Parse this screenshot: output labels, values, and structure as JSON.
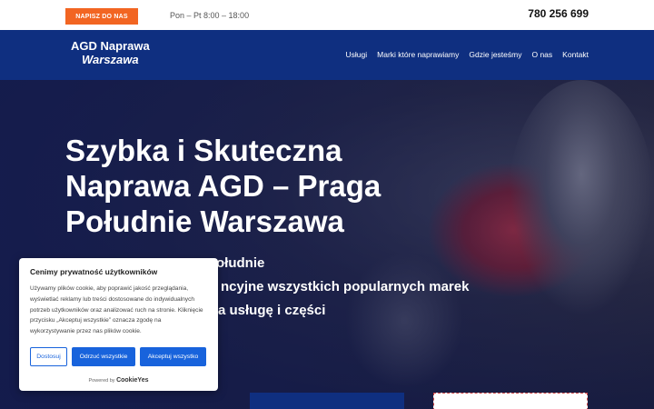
{
  "topbar": {
    "cta_label": "NAPISZ DO NAS",
    "hours": "Pon – Pt 8:00 – 18:00",
    "phone": "780 256 699"
  },
  "header": {
    "logo_line1": "AGD Naprawa",
    "logo_line2": "Warszawa",
    "nav": [
      "Usługi",
      "Marki które naprawiamy",
      "Gdzie jesteśmy",
      "O nas",
      "Kontakt"
    ]
  },
  "hero": {
    "title": "Szybka i Skuteczna Naprawa AGD – Praga Południe Warszawa",
    "bullets": [
      "ołudnie",
      "ncyjne wszystkich popularnych marek",
      "a usługę i części"
    ]
  },
  "cookie": {
    "title": "Cenimy prywatność użytkowników",
    "text": "Używamy plików cookie, aby poprawić jakość przeglądania, wyświetlać reklamy lub treści dostosowane do indywidualnych potrzeb użytkowników oraz analizować ruch na stronie. Kliknięcie przycisku „Akceptuj wszystkie” oznacza zgodę na wykorzystywanie przez nas plików cookie.",
    "customize_label": "Dostosuj",
    "reject_label": "Odrzuć wszystkie",
    "accept_label": "Akceptuj wszystko",
    "powered_by": "Powered by",
    "brand": "CookieYes"
  },
  "colors": {
    "accent_orange": "#f26522",
    "navy": "#0f2f80",
    "cookie_blue": "#1863dc"
  }
}
